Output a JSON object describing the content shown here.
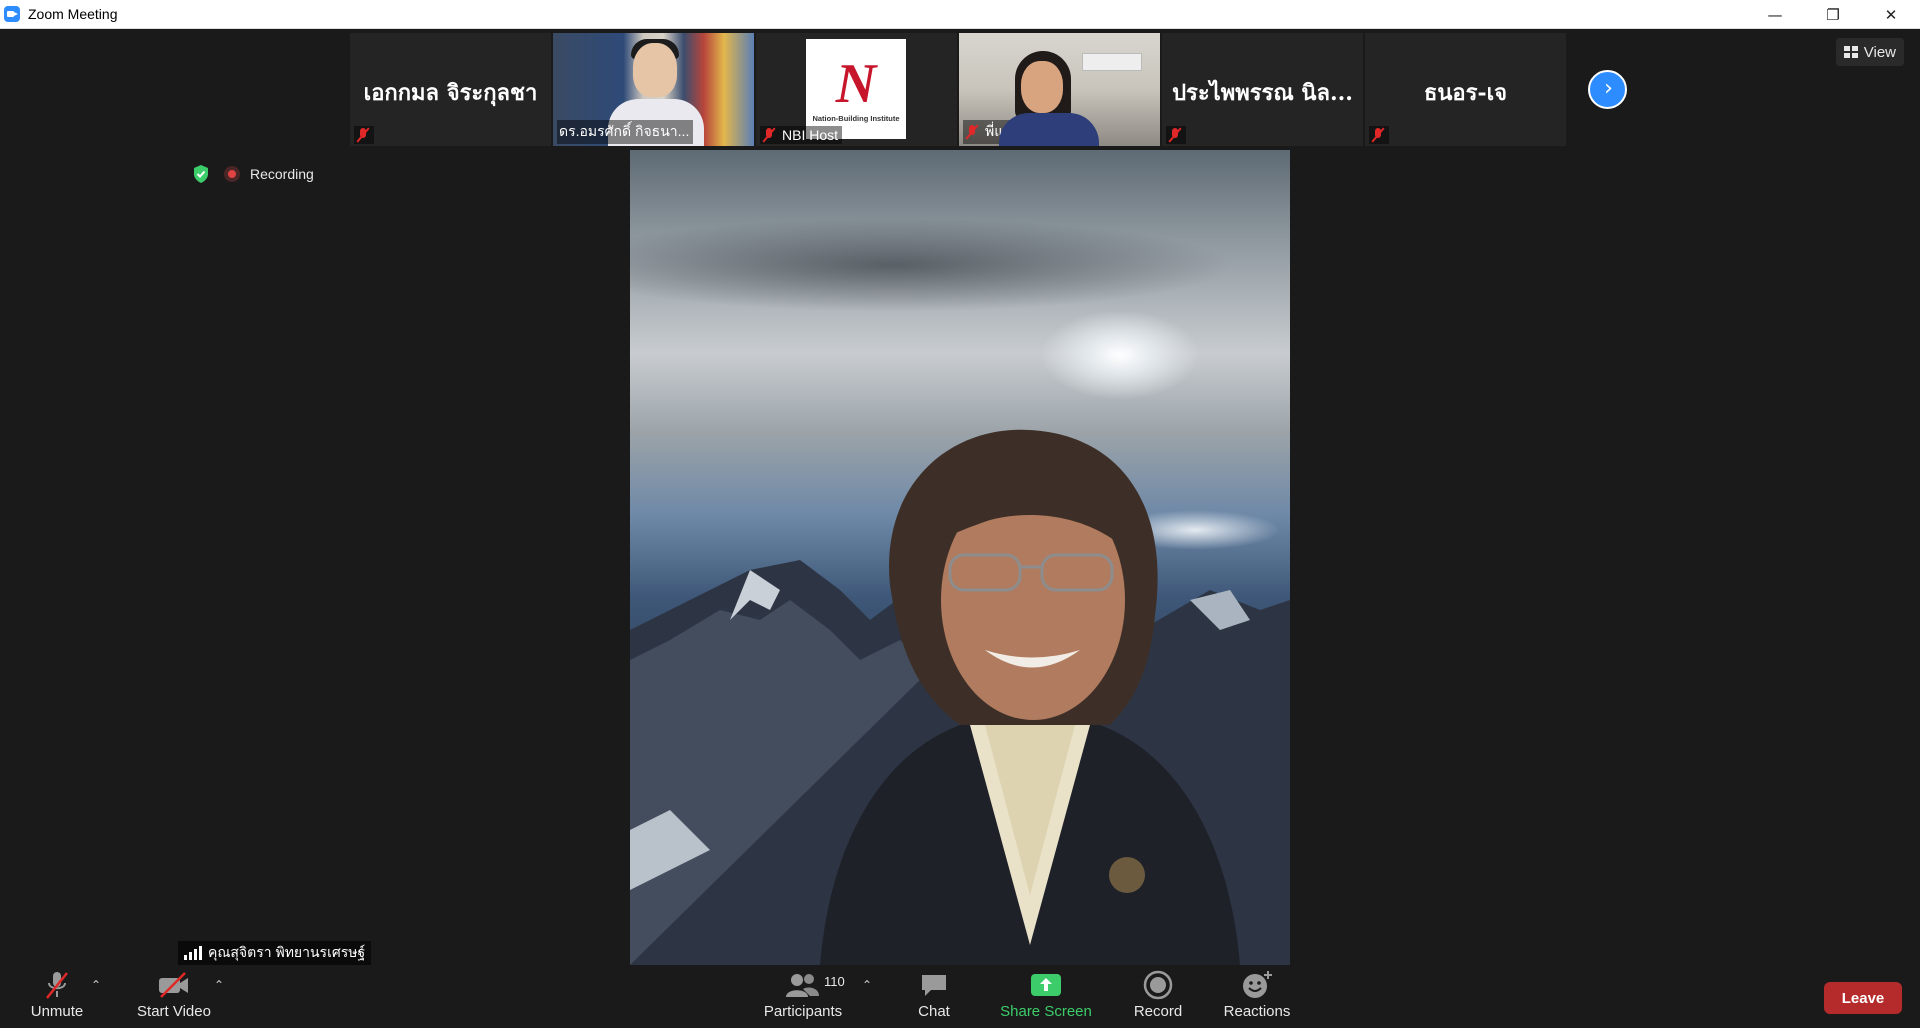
{
  "window": {
    "title": "Zoom Meeting"
  },
  "gallery": {
    "tiles": [
      {
        "type": "name",
        "name": "เอกกมล จิระกุลชา"
      },
      {
        "type": "video",
        "label": "ดร.อมรศักดิ์ กิจธนา..."
      },
      {
        "type": "logo",
        "label": "NBI Host",
        "logo_text": "Nation-Building Institute"
      },
      {
        "type": "video",
        "label": "พี่แอ๋ว NBI7"
      },
      {
        "type": "name",
        "name": "ประไพพรรณ นิล..."
      },
      {
        "type": "name",
        "name": "ธนอร-เจ"
      }
    ],
    "view_label": "View"
  },
  "status": {
    "recording_label": "Recording"
  },
  "main_video": {
    "participant_name": "คุณสุจิตรา พิทยานรเศรษฐ์"
  },
  "toolbar": {
    "unmute_label": "Unmute",
    "start_video_label": "Start Video",
    "participants_label": "Participants",
    "participants_count": "110",
    "chat_label": "Chat",
    "share_label": "Share Screen",
    "record_label": "Record",
    "reactions_label": "Reactions",
    "leave_label": "Leave"
  },
  "colors": {
    "accent_blue": "#2d8cff",
    "share_green": "#3ccd6a",
    "leave_red": "#b52b2b",
    "muted_red": "#e02828"
  }
}
